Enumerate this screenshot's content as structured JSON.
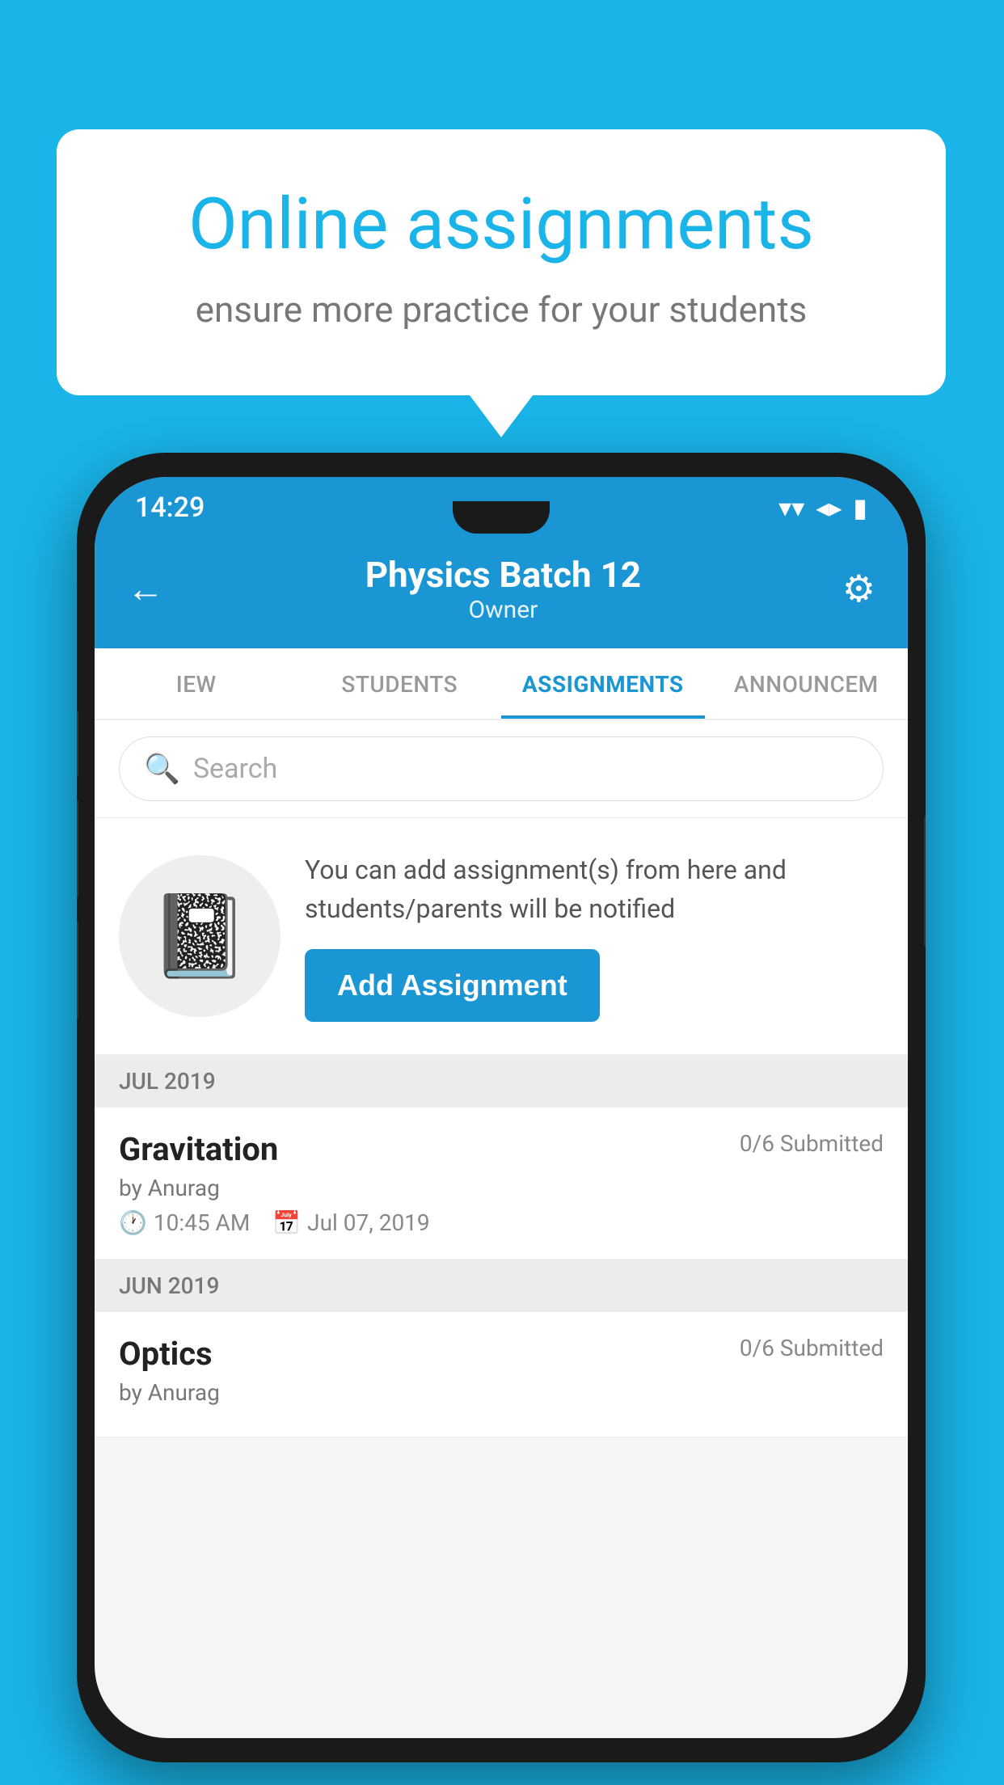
{
  "background": {
    "color": "#1ab4e8"
  },
  "speech_bubble": {
    "title": "Online assignments",
    "subtitle": "ensure more practice for your students"
  },
  "status_bar": {
    "time": "14:29",
    "wifi_icon": "▾",
    "signal_icon": "◂",
    "battery_icon": "▮"
  },
  "header": {
    "title": "Physics Batch 12",
    "subtitle": "Owner",
    "back_label": "←",
    "settings_label": "⚙"
  },
  "tabs": [
    {
      "label": "IEW",
      "active": false
    },
    {
      "label": "STUDENTS",
      "active": false
    },
    {
      "label": "ASSIGNMENTS",
      "active": true
    },
    {
      "label": "ANNOUNCEM",
      "active": false
    }
  ],
  "search": {
    "placeholder": "Search"
  },
  "promo": {
    "description": "You can add assignment(s) from here and students/parents will be notified",
    "button_label": "Add Assignment"
  },
  "sections": [
    {
      "month": "JUL 2019",
      "assignments": [
        {
          "name": "Gravitation",
          "submitted": "0/6 Submitted",
          "by": "by Anurag",
          "time": "10:45 AM",
          "date": "Jul 07, 2019"
        }
      ]
    },
    {
      "month": "JUN 2019",
      "assignments": [
        {
          "name": "Optics",
          "submitted": "0/6 Submitted",
          "by": "by Anurag",
          "time": "",
          "date": ""
        }
      ]
    }
  ]
}
